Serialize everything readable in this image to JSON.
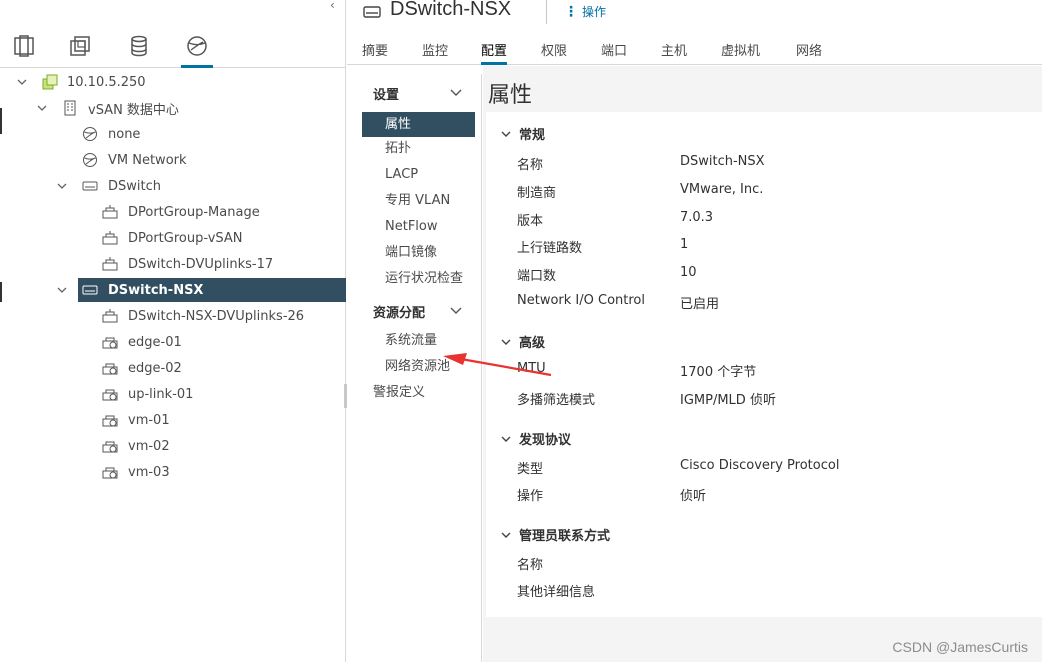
{
  "nav": {
    "collapse_glyph": "‹",
    "tabs": [
      {
        "icon": "hosts-clusters-icon"
      },
      {
        "icon": "vms-templates-icon"
      },
      {
        "icon": "storage-icon"
      },
      {
        "icon": "networking-icon"
      }
    ],
    "tree": [
      {
        "label": "10.10.5.250",
        "icon": "vcenter-icon",
        "expanded": true
      },
      {
        "label": "vSAN 数据中心",
        "icon": "datacenter-icon",
        "expanded": true
      },
      {
        "label": "none",
        "icon": "network-icon"
      },
      {
        "label": "VM Network",
        "icon": "network-icon"
      },
      {
        "label": "DSwitch",
        "icon": "dswitch-icon",
        "expanded": true
      },
      {
        "label": "DPortGroup-Manage",
        "icon": "portgroup-icon"
      },
      {
        "label": "DPortGroup-vSAN",
        "icon": "portgroup-icon"
      },
      {
        "label": "DSwitch-DVUplinks-17",
        "icon": "portgroup-icon"
      },
      {
        "label": "DSwitch-NSX",
        "icon": "dswitch-icon",
        "expanded": true,
        "selected": true
      },
      {
        "label": "DSwitch-NSX-DVUplinks-26",
        "icon": "portgroup-icon"
      },
      {
        "label": "edge-01",
        "icon": "nsx-segment-icon"
      },
      {
        "label": "edge-02",
        "icon": "nsx-segment-icon"
      },
      {
        "label": "up-link-01",
        "icon": "nsx-segment-icon"
      },
      {
        "label": "vm-01",
        "icon": "nsx-segment-icon"
      },
      {
        "label": "vm-02",
        "icon": "nsx-segment-icon"
      },
      {
        "label": "vm-03",
        "icon": "nsx-segment-icon"
      }
    ]
  },
  "header": {
    "title": "DSwitch-NSX",
    "actions_label": "操作"
  },
  "tabs": [
    "摘要",
    "监控",
    "配置",
    "权限",
    "端口",
    "主机",
    "虚拟机",
    "网络"
  ],
  "active_tab": "配置",
  "subnav": {
    "settings_head": "设置",
    "settings_items": [
      "属性",
      "拓扑",
      "LACP",
      "专用 VLAN",
      "NetFlow",
      "端口镜像",
      "运行状况检查"
    ],
    "resource_head": "资源分配",
    "resource_items": [
      "系统流量",
      "网络资源池"
    ],
    "alarm_item": "警报定义"
  },
  "content": {
    "title": "属性",
    "sections": [
      {
        "title": "常规",
        "rows": [
          {
            "label": "名称",
            "value": "DSwitch-NSX"
          },
          {
            "label": "制造商",
            "value": "VMware, Inc."
          },
          {
            "label": "版本",
            "value": "7.0.3"
          },
          {
            "label": "上行链路数",
            "value": "1"
          },
          {
            "label": "端口数",
            "value": "10"
          },
          {
            "label": "Network I/O Control",
            "value": "已启用"
          }
        ]
      },
      {
        "title": "高级",
        "rows": [
          {
            "label": "MTU",
            "value": "1700 个字节"
          },
          {
            "label": "多播筛选模式",
            "value": "IGMP/MLD 侦听"
          }
        ]
      },
      {
        "title": "发现协议",
        "rows": [
          {
            "label": "类型",
            "value": "Cisco Discovery Protocol"
          },
          {
            "label": "操作",
            "value": "侦听"
          }
        ]
      },
      {
        "title": "管理员联系方式",
        "rows": [
          {
            "label": "名称",
            "value": ""
          },
          {
            "label": "其他详细信息",
            "value": ""
          }
        ]
      }
    ]
  },
  "annotation_color": "#e8332f",
  "accent_color": "#0072a3",
  "selected_color": "#324f61",
  "watermark": "CSDN @JamesCurtis"
}
